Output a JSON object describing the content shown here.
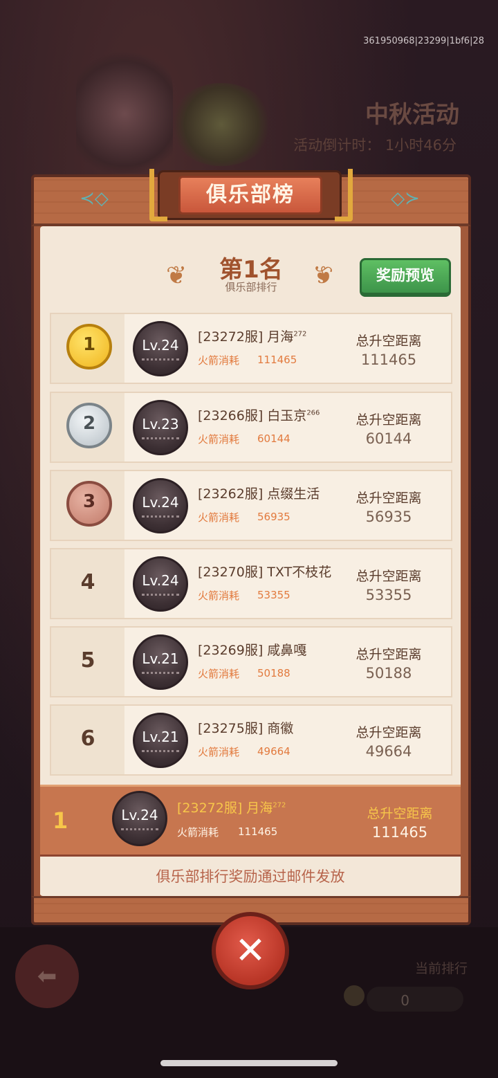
{
  "debug_text": "361950968|23299|1bf6|28",
  "background": {
    "event_title": "中秋活动",
    "countdown": "活动倒计时： 1小时46分",
    "current_rank_label": "当前排行",
    "rocket_count": "0"
  },
  "panel": {
    "title": "俱乐部榜",
    "my_rank": "第1名",
    "my_rank_sub": "俱乐部排行",
    "reward_preview_button": "奖励预览",
    "footer_note": "俱乐部排行奖励通过邮件发放"
  },
  "colors": {
    "accent_orange": "#e27a3e",
    "gold_text": "#f7c64a",
    "green_button": "#4caa55",
    "close_red": "#d04636"
  },
  "rows": [
    {
      "rank": "1",
      "medal": "gold",
      "level": "Lv.24",
      "name": "[23272服] 月海",
      "name_sup": "272",
      "fuel_label": "火箭消耗",
      "fuel": "111465",
      "dist_label": "总升空距离",
      "dist": "111465"
    },
    {
      "rank": "2",
      "medal": "silver",
      "level": "Lv.23",
      "name": "[23266服] 白玉京",
      "name_sup": "266",
      "fuel_label": "火箭消耗",
      "fuel": "60144",
      "dist_label": "总升空距离",
      "dist": "60144"
    },
    {
      "rank": "3",
      "medal": "bronze",
      "level": "Lv.24",
      "name": "[23262服] 点缀生活",
      "name_sup": "",
      "fuel_label": "火箭消耗",
      "fuel": "56935",
      "dist_label": "总升空距离",
      "dist": "56935"
    },
    {
      "rank": "4",
      "medal": "",
      "level": "Lv.24",
      "name": "[23270服] TXT不枝花",
      "name_sup": "",
      "fuel_label": "火箭消耗",
      "fuel": "53355",
      "dist_label": "总升空距离",
      "dist": "53355"
    },
    {
      "rank": "5",
      "medal": "",
      "level": "Lv.21",
      "name": "[23269服] 咸鼻嘎",
      "name_sup": "",
      "fuel_label": "火箭消耗",
      "fuel": "50188",
      "dist_label": "总升空距离",
      "dist": "50188"
    },
    {
      "rank": "6",
      "medal": "",
      "level": "Lv.21",
      "name": "[23275服] 商徽",
      "name_sup": "",
      "fuel_label": "火箭消耗",
      "fuel": "49664",
      "dist_label": "总升空距离",
      "dist": "49664"
    }
  ],
  "self_row": {
    "rank": "1",
    "level": "Lv.24",
    "name": "[23272服] 月海",
    "name_sup": "272",
    "fuel_label": "火箭消耗",
    "fuel": "111465",
    "dist_label": "总升空距离",
    "dist": "111465"
  },
  "icons": {
    "fish_left": "fish-icon",
    "fish_right": "fish-icon",
    "laurel_left": "laurel-icon",
    "laurel_right": "laurel-icon",
    "close": "close-icon",
    "back": "back-arrow-icon"
  }
}
